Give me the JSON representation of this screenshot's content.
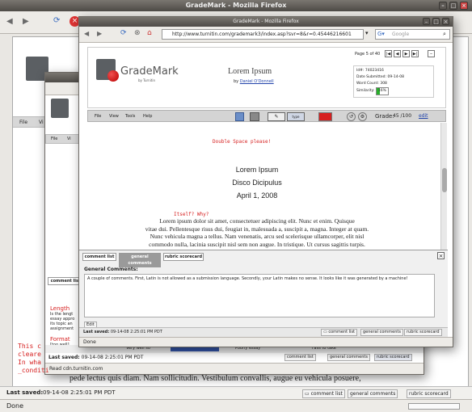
{
  "outer": {
    "title": "GradeMark - Mozilla Firefox",
    "url_fragment": "w",
    "menu": [
      "File",
      "Vi"
    ],
    "last_saved_label": "Last saved:",
    "last_saved_value": "09-14-08 2:25:01 PM PDT",
    "status": "Done",
    "bottom_buttons": [
      "comment list",
      "general comments",
      "rubric scorecard"
    ],
    "bg_text": "pede lectus quis diam. Nam sollicitudin. Vestibulum convallis, augue eu vehicula posuere,"
  },
  "middle": {
    "menu": [
      "File",
      "Vi"
    ],
    "comment_tab": "comment list",
    "left_texts": [
      "Length",
      "Is the lengt",
      "essay appro",
      "its topic an",
      "assignment",
      "Format",
      "[too well]"
    ],
    "left_red_lines": [
      "This c",
      "cleare",
      "In wha",
      "_conditi"
    ],
    "bar_items": [
      "Very well so",
      "Poorly essay",
      "Fails to take"
    ],
    "last_saved_label": "Last saved:",
    "last_saved_value": "09-14-08 2:25:01 PM PDT",
    "buttons": [
      "comment list",
      "general comments",
      "rubric scorecard"
    ],
    "status": "Read cdn.turnitin.com"
  },
  "front": {
    "title": "GradeMark - Mozilla Firefox",
    "url": "http://www.turnitin.com/grademark3/index.asp?svr=8&r=0.45446216601",
    "search_placeholder": "Google",
    "page_indicator": "Page 5 of 40",
    "brand": "GradeMark",
    "brand_byline": "by Turnitin",
    "doc_title": "Lorem Ipsum",
    "doc_author_prefix": "by",
    "doc_author": "Daniel O'Donnell",
    "info": {
      "id_label": "Id#:",
      "id_value": "74023416",
      "date_label": "Date Submitted:",
      "date_value": "09-14-08",
      "words_label": "Word Count:",
      "words_value": "308",
      "sim_label": "Similarity:",
      "sim_value": "16%"
    },
    "menu": [
      "File",
      "View",
      "Tools",
      "Help"
    ],
    "grade_label": "Grade:",
    "grade_value": "45 /100",
    "grade_edit": "edit",
    "type_btn": "type",
    "annotation_top": "Double Space please!",
    "paper_title": "Lorem Ipsum",
    "paper_author": "Disco Dicipulus",
    "paper_date": "April 1, 2008",
    "annotation_mid": "Itself? Why?",
    "paper_lines": [
      "Lorem ipsum dolor sit amet, consectetuer adipiscing elit. Nunc et enim. Quisque",
      "vitae dui. Pellentesque risus dui, feugiat in, malesuada a, suscipit a, magna. Integer at quam.",
      "Nunc vehicula magna a tellus. Nam venenatis, arcu sed scelerisque ullamcorper, elit nisl",
      "commodo nulla, lacinia suscipit nisl sem non augue. In tristique. Ut cursus sagittis turpis."
    ],
    "tabs": [
      "comment list",
      "general comments",
      "rubric scorecard"
    ],
    "gc_heading": "General Comments:",
    "gc_text": "A couple of comments. First, Latin is not allowed as a submission language. Secondly, your Latin makes no sense. It looks like it was generated by a machine!",
    "edit_btn": "Edit",
    "last_saved_label": "Last saved:",
    "last_saved_value": "09-14-08 2:25:01 PM PDT",
    "bottom_buttons": [
      "comment list",
      "general comments",
      "rubric scorecard"
    ],
    "status": "Done"
  },
  "colors": {
    "accent_red": "#d62020",
    "link": "#2244aa",
    "sim_green": "#27b02a"
  }
}
